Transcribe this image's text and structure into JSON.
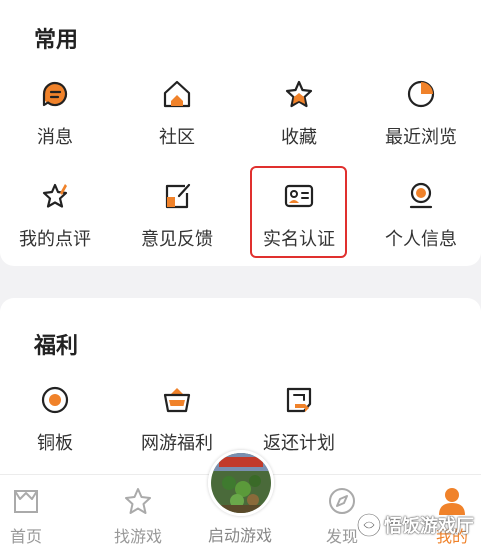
{
  "sections": {
    "common": {
      "title": "常用",
      "items": [
        {
          "label": "消息",
          "icon": "message-icon"
        },
        {
          "label": "社区",
          "icon": "home-community-icon"
        },
        {
          "label": "收藏",
          "icon": "star-collect-icon"
        },
        {
          "label": "最近浏览",
          "icon": "recent-pie-icon"
        },
        {
          "label": "我的点评",
          "icon": "star-review-icon"
        },
        {
          "label": "意见反馈",
          "icon": "feedback-icon"
        },
        {
          "label": "实名认证",
          "icon": "id-card-icon"
        },
        {
          "label": "个人信息",
          "icon": "profile-icon"
        }
      ]
    },
    "welfare": {
      "title": "福利",
      "items": [
        {
          "label": "铜板",
          "icon": "coin-icon"
        },
        {
          "label": "网游福利",
          "icon": "gift-basket-icon"
        },
        {
          "label": "返还计划",
          "icon": "return-plan-icon"
        }
      ]
    }
  },
  "tabbar": {
    "home": "首页",
    "find_games": "找游戏",
    "launch_game": "启动游戏",
    "discover": "发现",
    "mine": "我的"
  },
  "watermark": "悟饭游戏厅",
  "colors": {
    "accent": "#f0822a",
    "highlight_border": "#e0302e",
    "icon_stroke": "#222222"
  }
}
